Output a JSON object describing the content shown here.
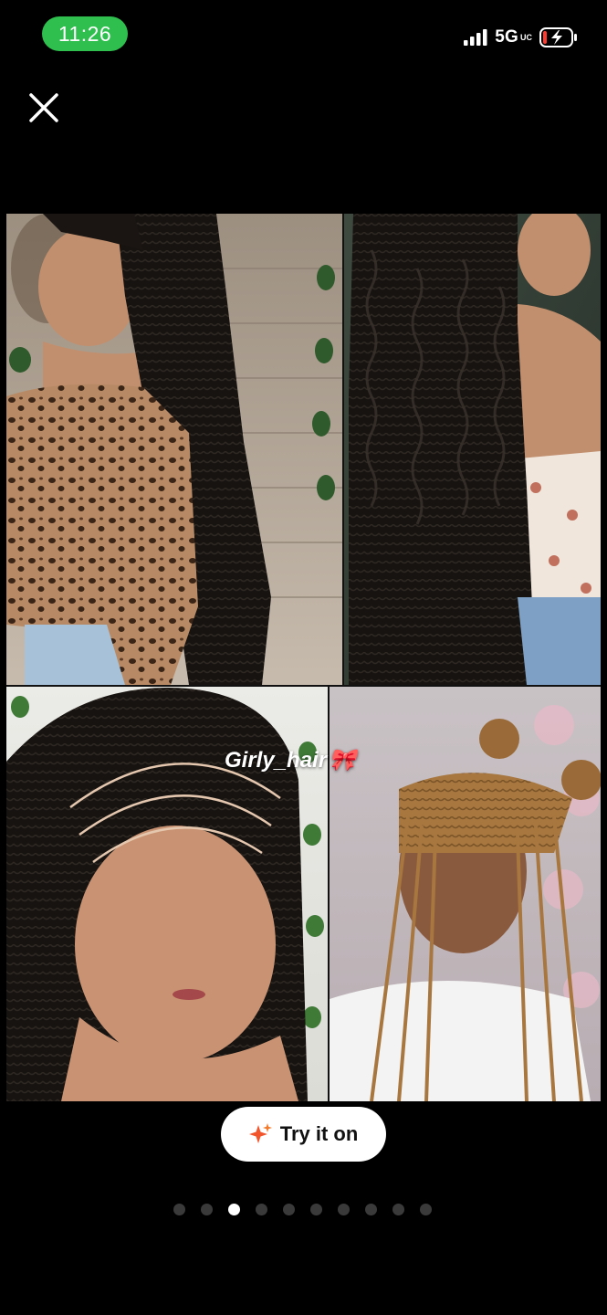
{
  "status_bar": {
    "time": "11:26",
    "network": "5G",
    "network_sub": "UC",
    "signal_icon": "cellular-signal-icon",
    "battery_icon": "battery-charging-icon",
    "battery_color": "#ff3b30",
    "time_pill_color": "#2fbf4f"
  },
  "header": {
    "close_icon": "close-icon"
  },
  "pin": {
    "watermark": "Girly_hair",
    "watermark_emoji": "🎀",
    "image_description_icon": "image-collage"
  },
  "actions": {
    "try_on_label": "Try it on",
    "try_on_icon": "sparkle-icon",
    "sparkle_color": "#f2552c"
  },
  "pagination": {
    "total": 10,
    "active_index": 2
  }
}
